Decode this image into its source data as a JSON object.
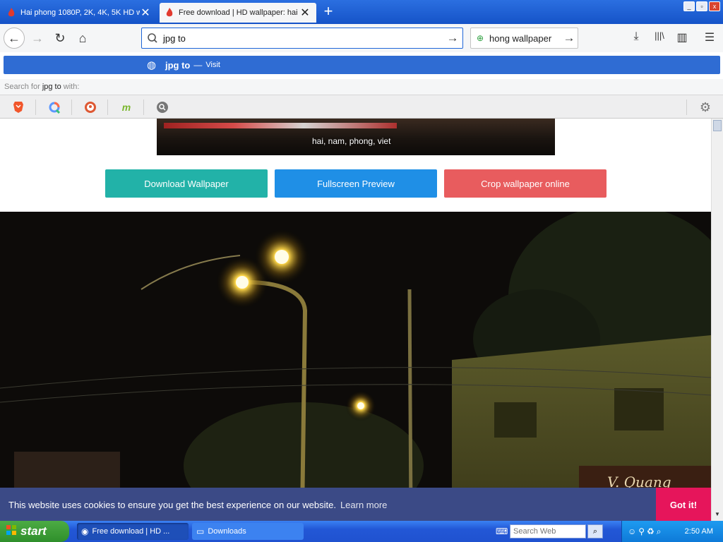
{
  "tabs": [
    {
      "title": "Hai phong 1080P, 2K, 4K, 5K HD w",
      "close": "✕"
    },
    {
      "title": "Free download | HD wallpaper: hai",
      "close": "✕"
    }
  ],
  "new_tab": "+",
  "window_controls": {
    "minimize": "_",
    "maximize": "▫",
    "close": "x"
  },
  "navbar": {
    "back_icon": "←",
    "forward_icon": "→",
    "reload_icon": "↻",
    "home_icon": "⌂",
    "url_value": "jpg to ",
    "url_go": "→",
    "search_value": "hong wallpaper",
    "search_go": "→",
    "download_icon": "⤓",
    "library_icon": "|||\\",
    "sidebar_icon": "▥",
    "menu_icon": "☰"
  },
  "suggestion": {
    "text": "jpg to",
    "dash": "—",
    "visit": "Visit"
  },
  "search_for": {
    "prefix": "Search for",
    "query": "jpg to",
    "suffix": "with:"
  },
  "engines": [
    "brave-icon",
    "qwant-icon",
    "duckduckgo-icon",
    "mojeek-icon",
    "search-icon"
  ],
  "engine_settings_icon": "⚙",
  "page": {
    "thumb_caption": "hai, nam, phong, viet",
    "buttons": {
      "download": "Download Wallpaper",
      "fullscreen": "Fullscreen Preview",
      "crop": "Crop wallpaper online"
    },
    "colors": {
      "download": "#22b2a8",
      "fullscreen": "#1f8fe6",
      "crop": "#e85c5e"
    },
    "sign_text": "V. Quang"
  },
  "cookie": {
    "message": "This website uses cookies to ensure you get the best experience on our website.",
    "learn_more": "Learn more",
    "accept": "Got it!"
  },
  "taskbar": {
    "start": "start",
    "tasks": [
      {
        "label": "Free download | HD ..."
      },
      {
        "label": "Downloads"
      }
    ],
    "search_placeholder": "Search Web",
    "clock": "2:50 AM"
  }
}
